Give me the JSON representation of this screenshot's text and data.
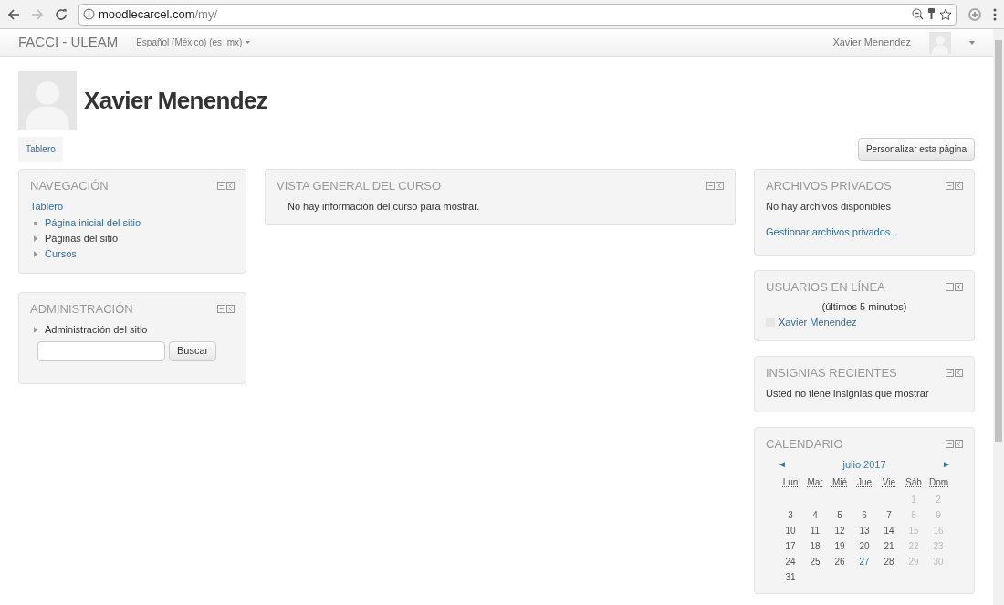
{
  "browser": {
    "url_host": "moodlecarcel.com",
    "url_path": "/my/"
  },
  "navbar": {
    "brand": "FACCI - ULEAM",
    "language": "Español (México) (es_mx)",
    "user": "Xavier Menendez"
  },
  "header": {
    "name": "Xavier Menendez",
    "tabs": [
      {
        "label": "Tablero",
        "selected": true
      }
    ],
    "customize_button": "Personalizar esta página"
  },
  "navigation": {
    "title": "NAVEGACIÓN",
    "home": "Tablero",
    "items": [
      {
        "label": "Página inicial del sitio",
        "kind": "leaf",
        "link": true
      },
      {
        "label": "Páginas del sitio",
        "kind": "branch",
        "link": false
      },
      {
        "label": "Cursos",
        "kind": "branch",
        "link": true
      }
    ]
  },
  "administration": {
    "title": "ADMINISTRACIÓN",
    "items": [
      {
        "label": "Administración del sitio",
        "kind": "branch",
        "link": false
      }
    ],
    "search_button": "Buscar"
  },
  "course_overview": {
    "title": "VISTA GENERAL DEL CURSO",
    "message": "No hay información del curso para mostrar."
  },
  "private_files": {
    "title": "ARCHIVOS PRIVADOS",
    "message": "No hay archivos disponibles",
    "link": "Gestionar archivos privados..."
  },
  "online_users": {
    "title": "USUARIOS EN LÍNEA",
    "period": "(últimos 5 minutos)",
    "users": [
      "Xavier Menendez"
    ]
  },
  "badges": {
    "title": "INSIGNIAS RECIENTES",
    "message": "Usted no tiene insignias que mostrar"
  },
  "calendar": {
    "title": "CALENDARIO",
    "month": "julio 2017",
    "prev": "◄",
    "next": "►",
    "weekdays": [
      "Lun",
      "Mar",
      "Mié",
      "Jue",
      "Vie",
      "Sáb",
      "Dom"
    ],
    "weeks": [
      [
        {
          "kind": "blank"
        },
        {
          "kind": "blank"
        },
        {
          "kind": "blank"
        },
        {
          "kind": "blank"
        },
        {
          "kind": "blank"
        },
        {
          "kind": "weekend",
          "day": "1"
        },
        {
          "kind": "weekend",
          "day": "2"
        }
      ],
      [
        {
          "kind": "weekday",
          "day": "3"
        },
        {
          "kind": "weekday",
          "day": "4"
        },
        {
          "kind": "weekday",
          "day": "5"
        },
        {
          "kind": "weekday",
          "day": "6"
        },
        {
          "kind": "weekday",
          "day": "7"
        },
        {
          "kind": "weekend",
          "day": "8"
        },
        {
          "kind": "weekend",
          "day": "9"
        }
      ],
      [
        {
          "kind": "weekday",
          "day": "10"
        },
        {
          "kind": "weekday",
          "day": "11"
        },
        {
          "kind": "weekday",
          "day": "12"
        },
        {
          "kind": "weekday",
          "day": "13"
        },
        {
          "kind": "weekday",
          "day": "14"
        },
        {
          "kind": "weekend",
          "day": "15"
        },
        {
          "kind": "weekend",
          "day": "16"
        }
      ],
      [
        {
          "kind": "weekday",
          "day": "17"
        },
        {
          "kind": "weekday",
          "day": "18"
        },
        {
          "kind": "weekday",
          "day": "19"
        },
        {
          "kind": "weekday",
          "day": "20"
        },
        {
          "kind": "weekday",
          "day": "21"
        },
        {
          "kind": "weekend",
          "day": "22"
        },
        {
          "kind": "weekend",
          "day": "23"
        }
      ],
      [
        {
          "kind": "weekday",
          "day": "24"
        },
        {
          "kind": "weekday",
          "day": "25"
        },
        {
          "kind": "weekday",
          "day": "26"
        },
        {
          "kind": "today",
          "day": "27"
        },
        {
          "kind": "weekday",
          "day": "28"
        },
        {
          "kind": "weekend",
          "day": "29"
        },
        {
          "kind": "weekend",
          "day": "30"
        }
      ],
      [
        {
          "kind": "weekday",
          "day": "31"
        }
      ]
    ]
  }
}
